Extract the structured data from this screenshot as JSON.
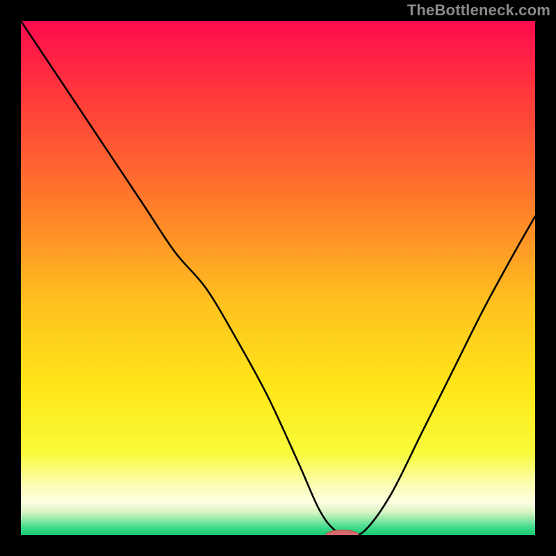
{
  "watermark": "TheBottleneck.com",
  "palette": {
    "black": "#000000",
    "curve": "#000000",
    "marker_fill": "#d46a6a",
    "marker_stroke": "#b74d4d"
  },
  "chart_data": {
    "type": "line",
    "title": "",
    "xlabel": "",
    "ylabel": "",
    "xlim": [
      0,
      100
    ],
    "ylim": [
      0,
      100
    ],
    "grid": false,
    "legend": false,
    "background_gradient_stops": [
      {
        "pos": 0.0,
        "color": "#ff0b4f"
      },
      {
        "pos": 0.15,
        "color": "#ff3a3a"
      },
      {
        "pos": 0.35,
        "color": "#ff7a2a"
      },
      {
        "pos": 0.55,
        "color": "#ffc21e"
      },
      {
        "pos": 0.72,
        "color": "#ffe81a"
      },
      {
        "pos": 0.84,
        "color": "#f8fa3a"
      },
      {
        "pos": 0.9,
        "color": "#fbfdb0"
      },
      {
        "pos": 0.935,
        "color": "#fefee1"
      },
      {
        "pos": 0.955,
        "color": "#d9f4c4"
      },
      {
        "pos": 0.97,
        "color": "#8fe8a8"
      },
      {
        "pos": 0.985,
        "color": "#3fdc8b"
      },
      {
        "pos": 1.0,
        "color": "#16c76f"
      }
    ],
    "x": [
      0,
      6,
      12,
      18,
      24,
      30,
      36,
      42,
      48,
      54,
      58,
      61,
      64,
      67,
      72,
      78,
      84,
      90,
      96,
      100
    ],
    "y": [
      100,
      91,
      82,
      73,
      64,
      55,
      48,
      38,
      27,
      14,
      5,
      1,
      0,
      1,
      8,
      20,
      32,
      44,
      55,
      62
    ],
    "minimum_marker": {
      "x": 62.5,
      "y": 0,
      "rx_pct": 3.2,
      "ry_pct": 1.0
    }
  }
}
